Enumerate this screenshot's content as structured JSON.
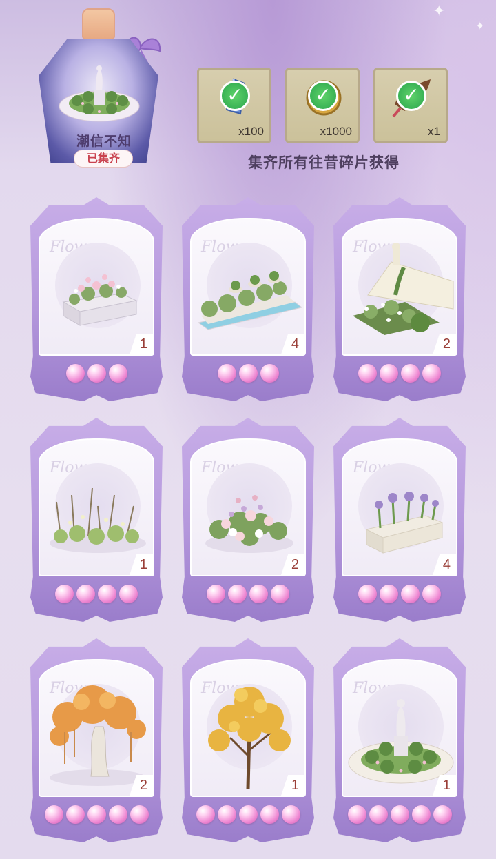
{
  "header": {
    "bottle_name": "潮信不知",
    "bottle_status": "已集齐",
    "collect_note": "集齐所有往昔碎片获得"
  },
  "rewards": [
    {
      "name": "blue-crystal-icon",
      "qty": "x100",
      "claimed": true
    },
    {
      "name": "clover-coin-icon",
      "qty": "x1000",
      "claimed": true
    },
    {
      "name": "flower-bouquet-icon",
      "qty": "x1",
      "claimed": true
    }
  ],
  "cards": [
    {
      "item": "flower-planter",
      "count": "1",
      "pearls": 3
    },
    {
      "item": "fountain-hedge",
      "count": "4",
      "pearls": 3
    },
    {
      "item": "garden-wall-bed",
      "count": "2",
      "pearls": 4
    },
    {
      "item": "wild-grass-patch",
      "count": "1",
      "pearls": 4
    },
    {
      "item": "rose-bush",
      "count": "2",
      "pearls": 4
    },
    {
      "item": "iris-planter",
      "count": "4",
      "pearls": 4
    },
    {
      "item": "autumn-banyan-tree",
      "count": "2",
      "pearls": 5
    },
    {
      "item": "golden-maple-tree",
      "count": "1",
      "pearls": 5
    },
    {
      "item": "statue-garden",
      "count": "1",
      "pearls": 5
    }
  ],
  "colors": {
    "accent_purple": "#b497dc",
    "pearl_pink": "#ee87d2",
    "count_red": "#9a3f38",
    "status_red": "#c9424f"
  }
}
